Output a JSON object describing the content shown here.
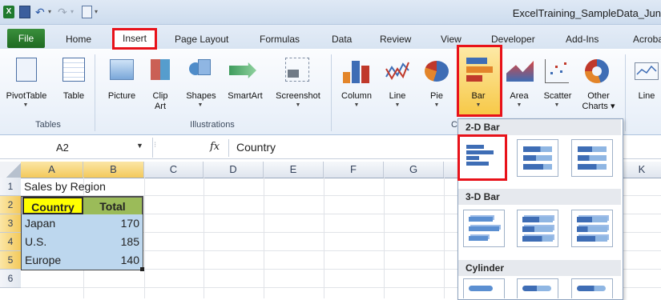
{
  "window": {
    "title": "ExcelTraining_SampleData_Jun"
  },
  "tabs": {
    "file": "File",
    "home": "Home",
    "insert": "Insert",
    "page_layout": "Page Layout",
    "formulas": "Formulas",
    "data": "Data",
    "review": "Review",
    "view": "View",
    "developer": "Developer",
    "addins": "Add-Ins",
    "acrobat": "Acrobat"
  },
  "ribbon": {
    "tables": {
      "label": "Tables",
      "pivottable": "PivotTable",
      "table": "Table"
    },
    "illustrations": {
      "label": "Illustrations",
      "picture": "Picture",
      "clip_art_1": "Clip",
      "clip_art_2": "Art",
      "shapes": "Shapes",
      "smartart": "SmartArt",
      "screenshot": "Screenshot"
    },
    "charts": {
      "column": "Column",
      "line": "Line",
      "pie": "Pie",
      "bar": "Bar",
      "area": "Area",
      "scatter": "Scatter",
      "other_1": "Other",
      "other_2": "Charts ▾"
    },
    "sparklines": {
      "line": "Line"
    },
    "group_fragment": "C"
  },
  "formula_bar": {
    "name_box": "A2",
    "fx": "fx",
    "value": "Country"
  },
  "columns": [
    "A",
    "B",
    "C",
    "D",
    "E",
    "F",
    "G",
    "K"
  ],
  "rows": [
    "1",
    "2",
    "3",
    "4",
    "5",
    "6"
  ],
  "sheet": {
    "a1": "Sales by Region",
    "header": {
      "country": "Country",
      "total": "Total"
    },
    "data": [
      {
        "country": "Japan",
        "total": "170"
      },
      {
        "country": "U.S.",
        "total": "185"
      },
      {
        "country": "Europe",
        "total": "140"
      }
    ]
  },
  "bar_dropdown": {
    "section_2d": "2-D Bar",
    "section_3d": "3-D Bar",
    "section_cylinder": "Cylinder"
  },
  "colors": {
    "file_tab": "#2e7d32",
    "highlight": "#e8121a",
    "header_fill": "#ffff00",
    "data_fill": "#bdd7ee",
    "header_total_fill": "#9bbb59"
  }
}
